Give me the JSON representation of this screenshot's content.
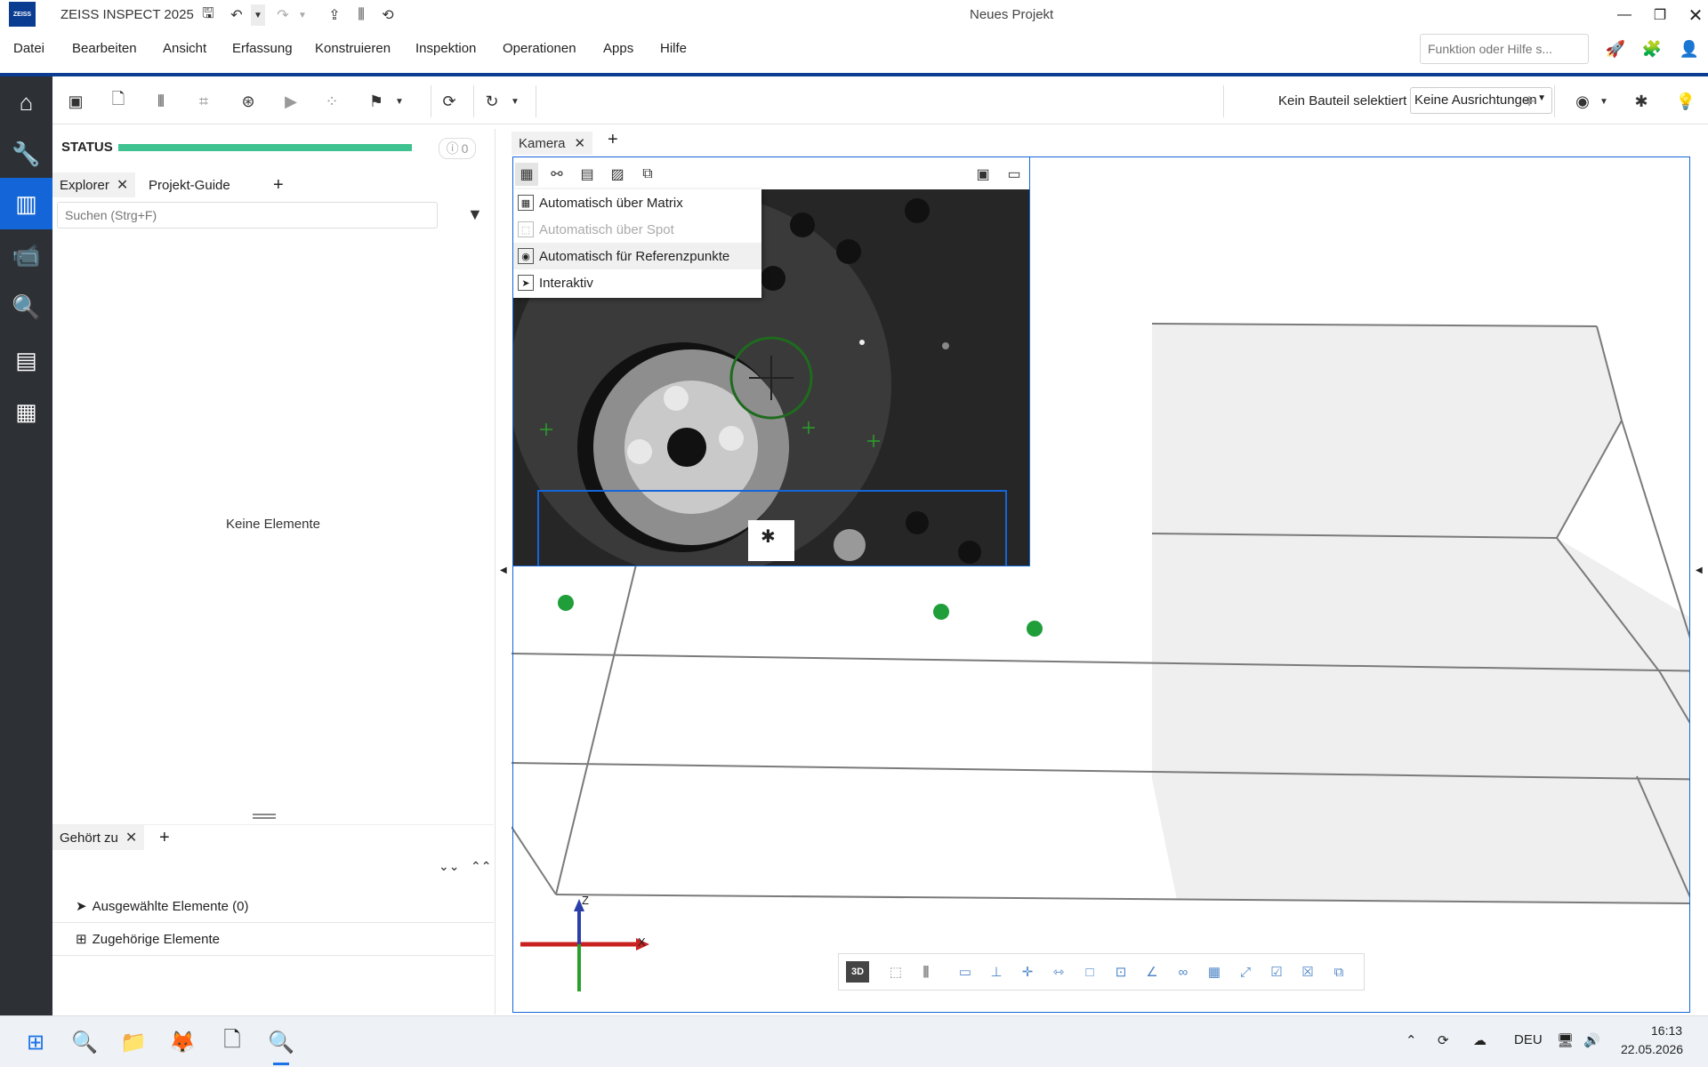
{
  "window": {
    "app_title": "ZEISS INSPECT 2025",
    "document_title": "Neues Projekt",
    "logo_text": "ZEISS"
  },
  "menu": {
    "items": [
      "Datei",
      "Bearbeiten",
      "Ansicht",
      "Erfassung",
      "Konstruieren",
      "Inspektion",
      "Operationen",
      "Apps",
      "Hilfe"
    ],
    "search_placeholder": "Funktion oder Hilfe s..."
  },
  "toolbar": {
    "part_status": "Kein Bauteil selektiert",
    "alignment_select": "Keine Ausrichtungen"
  },
  "left_panel": {
    "status_label": "STATUS",
    "status_progress": 1.0,
    "status_count": "0",
    "tabs": [
      {
        "label": "Explorer",
        "closable": true
      },
      {
        "label": "Projekt-Guide",
        "closable": false
      }
    ],
    "search_placeholder": "Suchen (Strg+F)",
    "empty_text": "Keine Elemente",
    "bottom_tab": "Gehört zu",
    "rows": [
      "Ausgewählte Elemente (0)",
      "Zugehörige Elemente"
    ]
  },
  "viewport": {
    "tab_label": "Kamera",
    "axis_x": "X",
    "axis_z": "Z",
    "view_mode": "3D"
  },
  "camera_menu": {
    "items": [
      {
        "label": "Automatisch über Matrix",
        "enabled": true
      },
      {
        "label": "Automatisch über Spot",
        "enabled": false
      },
      {
        "label": "Automatisch für Referenzpunkte",
        "enabled": true
      },
      {
        "label": "Interaktiv",
        "enabled": true
      }
    ]
  },
  "taskbar": {
    "language": "DEU",
    "time": "16:13",
    "date": "22.05.2026"
  },
  "colors": {
    "accent": "#1466d8",
    "brand_blue": "#0a3d91",
    "nav_bg": "#2d3035",
    "status_green": "#3ec28f",
    "point_green": "#1f9e3a"
  }
}
